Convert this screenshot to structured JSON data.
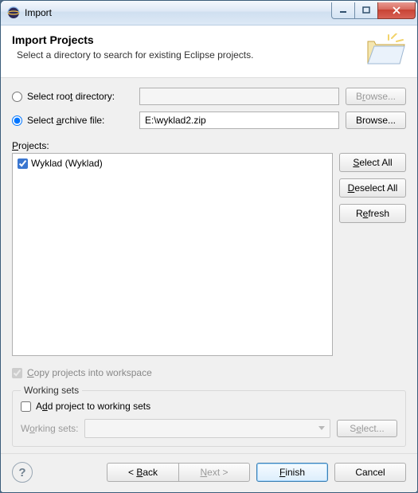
{
  "window": {
    "title": "Import"
  },
  "header": {
    "title": "Import Projects",
    "subtitle": "Select a directory to search for existing Eclipse projects."
  },
  "form": {
    "root_dir_label_pre": "Select roo",
    "root_dir_label_u": "t",
    "root_dir_label_post": " directory:",
    "archive_label_pre": "Select ",
    "archive_label_u": "a",
    "archive_label_post": "rchive file:",
    "archive_value": "E:\\wyklad2.zip",
    "browse_label_pre": "B",
    "browse_label_u": "r",
    "browse_label_post": "owse...",
    "browse2_label": "Browse..."
  },
  "projects": {
    "label_u": "P",
    "label_post": "rojects:",
    "items": [
      {
        "checked": true,
        "label": "Wyklad (Wyklad)"
      }
    ],
    "select_all_u": "S",
    "select_all_post": "elect All",
    "deselect_all_u": "D",
    "deselect_all_post": "eselect All",
    "refresh_pre": "R",
    "refresh_u": "e",
    "refresh_post": "fresh"
  },
  "copy": {
    "label_u": "C",
    "label_post": "opy projects into workspace",
    "checked": true
  },
  "working_sets": {
    "legend": "Working sets",
    "add_label_pre": "A",
    "add_label_u": "d",
    "add_label_post": "d project to working sets",
    "combo_label_pre": "W",
    "combo_label_u": "o",
    "combo_label_post": "rking sets:",
    "select_pre": "S",
    "select_u": "e",
    "select_post": "lect..."
  },
  "footer": {
    "back_pre": "< ",
    "back_u": "B",
    "back_post": "ack",
    "next_u": "N",
    "next_post": "ext >",
    "finish_u": "F",
    "finish_post": "inish",
    "cancel": "Cancel"
  }
}
